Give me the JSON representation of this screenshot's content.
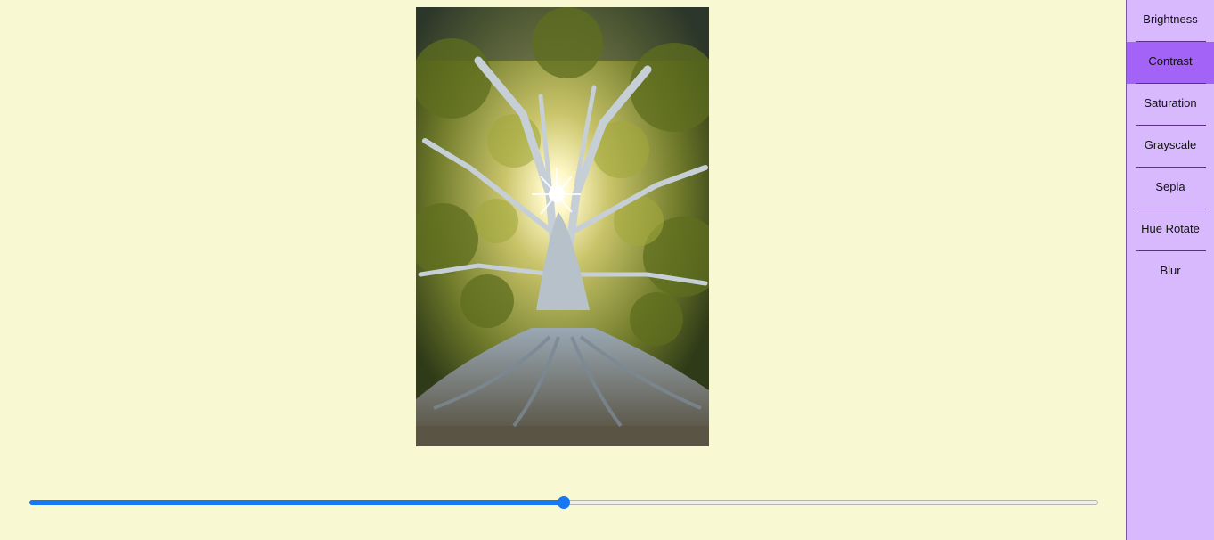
{
  "app": {
    "background_color": "#f8f8d2"
  },
  "image": {
    "description_icon": "tree-photo"
  },
  "slider": {
    "value_percent": 50,
    "min": 0,
    "max": 100,
    "accent_color": "#1877f2"
  },
  "sidebar": {
    "background_color": "#d8b9fd",
    "active_color": "#a463f7",
    "items": [
      {
        "label": "Brightness",
        "active": false
      },
      {
        "label": "Contrast",
        "active": true
      },
      {
        "label": "Saturation",
        "active": false
      },
      {
        "label": "Grayscale",
        "active": false
      },
      {
        "label": "Sepia",
        "active": false
      },
      {
        "label": "Hue Rotate",
        "active": false
      },
      {
        "label": "Blur",
        "active": false
      }
    ]
  }
}
